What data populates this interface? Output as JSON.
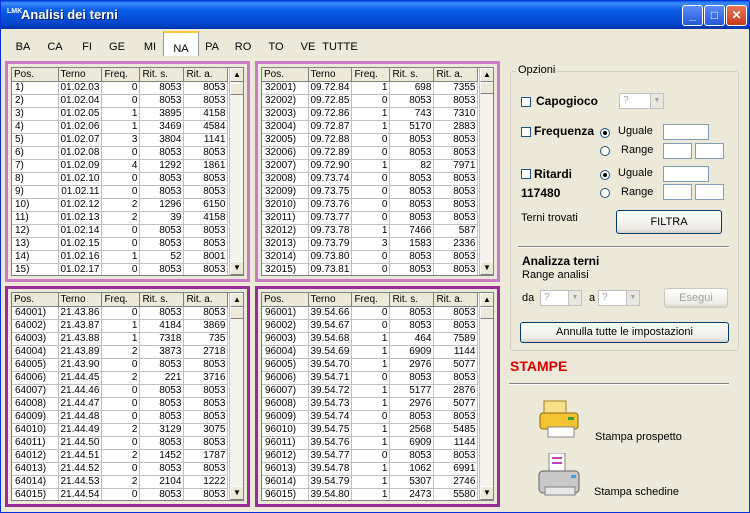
{
  "window": {
    "title": "Analisi dei terni",
    "icon_text": "LMK"
  },
  "title_buttons": {
    "minimize": "_",
    "maximize": "□",
    "close": "✕"
  },
  "tabs": [
    "BA",
    "CA",
    "FI",
    "GE",
    "MI",
    "NA",
    "PA",
    "RO",
    "TO",
    "VE",
    "TUTTE"
  ],
  "active_tab": "NA",
  "columns": [
    "Pos.",
    "Terno",
    "Freq.",
    "Rit. s.",
    "Rit. a."
  ],
  "grids": [
    {
      "rows": [
        [
          "1)",
          "01.02.03",
          "0",
          "8053",
          "8053"
        ],
        [
          "2)",
          "01.02.04",
          "0",
          "8053",
          "8053"
        ],
        [
          "3)",
          "01.02.05",
          "1",
          "3895",
          "4158"
        ],
        [
          "4)",
          "01.02.06",
          "1",
          "3469",
          "4584"
        ],
        [
          "5)",
          "01.02.07",
          "3",
          "3804",
          "1141"
        ],
        [
          "6)",
          "01.02.08",
          "0",
          "8053",
          "8053"
        ],
        [
          "7)",
          "01.02.09",
          "4",
          "1292",
          "1861"
        ],
        [
          "8)",
          "01.02.10",
          "0",
          "8053",
          "8053"
        ],
        [
          "9)",
          "01.02.11",
          "0",
          "8053",
          "8053"
        ],
        [
          "10)",
          "01.02.12",
          "2",
          "1296",
          "6150"
        ],
        [
          "11)",
          "01.02.13",
          "2",
          "39",
          "4158"
        ],
        [
          "12)",
          "01.02.14",
          "0",
          "8053",
          "8053"
        ],
        [
          "13)",
          "01.02.15",
          "0",
          "8053",
          "8053"
        ],
        [
          "14)",
          "01.02.16",
          "1",
          "52",
          "8001"
        ],
        [
          "15)",
          "01.02.17",
          "0",
          "8053",
          "8053"
        ]
      ]
    },
    {
      "rows": [
        [
          "32001)",
          "09.72.84",
          "1",
          "698",
          "7355"
        ],
        [
          "32002)",
          "09.72.85",
          "0",
          "8053",
          "8053"
        ],
        [
          "32003)",
          "09.72.86",
          "1",
          "743",
          "7310"
        ],
        [
          "32004)",
          "09.72.87",
          "1",
          "5170",
          "2883"
        ],
        [
          "32005)",
          "09.72.88",
          "0",
          "8053",
          "8053"
        ],
        [
          "32006)",
          "09.72.89",
          "0",
          "8053",
          "8053"
        ],
        [
          "32007)",
          "09.72.90",
          "1",
          "82",
          "7971"
        ],
        [
          "32008)",
          "09.73.74",
          "0",
          "8053",
          "8053"
        ],
        [
          "32009)",
          "09.73.75",
          "0",
          "8053",
          "8053"
        ],
        [
          "32010)",
          "09.73.76",
          "0",
          "8053",
          "8053"
        ],
        [
          "32011)",
          "09.73.77",
          "0",
          "8053",
          "8053"
        ],
        [
          "32012)",
          "09.73.78",
          "1",
          "7466",
          "587"
        ],
        [
          "32013)",
          "09.73.79",
          "3",
          "1583",
          "2336"
        ],
        [
          "32014)",
          "09.73.80",
          "0",
          "8053",
          "8053"
        ],
        [
          "32015)",
          "09.73.81",
          "0",
          "8053",
          "8053"
        ]
      ]
    },
    {
      "rows": [
        [
          "64001)",
          "21.43.86",
          "0",
          "8053",
          "8053"
        ],
        [
          "64002)",
          "21.43.87",
          "1",
          "4184",
          "3869"
        ],
        [
          "64003)",
          "21.43.88",
          "1",
          "7318",
          "735"
        ],
        [
          "64004)",
          "21.43.89",
          "2",
          "3873",
          "2718"
        ],
        [
          "64005)",
          "21.43.90",
          "0",
          "8053",
          "8053"
        ],
        [
          "64006)",
          "21.44.45",
          "2",
          "221",
          "3716"
        ],
        [
          "64007)",
          "21.44.46",
          "0",
          "8053",
          "8053"
        ],
        [
          "64008)",
          "21.44.47",
          "0",
          "8053",
          "8053"
        ],
        [
          "64009)",
          "21.44.48",
          "0",
          "8053",
          "8053"
        ],
        [
          "64010)",
          "21.44.49",
          "2",
          "3129",
          "3075"
        ],
        [
          "64011)",
          "21.44.50",
          "0",
          "8053",
          "8053"
        ],
        [
          "64012)",
          "21.44.51",
          "2",
          "1452",
          "1787"
        ],
        [
          "64013)",
          "21.44.52",
          "0",
          "8053",
          "8053"
        ],
        [
          "64014)",
          "21.44.53",
          "2",
          "2104",
          "1222"
        ],
        [
          "64015)",
          "21.44.54",
          "0",
          "8053",
          "8053"
        ]
      ]
    },
    {
      "rows": [
        [
          "96001)",
          "39.54.66",
          "0",
          "8053",
          "8053"
        ],
        [
          "96002)",
          "39.54.67",
          "0",
          "8053",
          "8053"
        ],
        [
          "96003)",
          "39.54.68",
          "1",
          "464",
          "7589"
        ],
        [
          "96004)",
          "39.54.69",
          "1",
          "6909",
          "1144"
        ],
        [
          "96005)",
          "39.54.70",
          "1",
          "2976",
          "5077"
        ],
        [
          "96006)",
          "39.54.71",
          "0",
          "8053",
          "8053"
        ],
        [
          "96007)",
          "39.54.72",
          "1",
          "5177",
          "2876"
        ],
        [
          "96008)",
          "39.54.73",
          "1",
          "2976",
          "5077"
        ],
        [
          "96009)",
          "39.54.74",
          "0",
          "8053",
          "8053"
        ],
        [
          "96010)",
          "39.54.75",
          "1",
          "2568",
          "5485"
        ],
        [
          "96011)",
          "39.54.76",
          "1",
          "6909",
          "1144"
        ],
        [
          "96012)",
          "39.54.77",
          "0",
          "8053",
          "8053"
        ],
        [
          "96013)",
          "39.54.78",
          "1",
          "1062",
          "6991"
        ],
        [
          "96014)",
          "39.54.79",
          "1",
          "5307",
          "2746"
        ],
        [
          "96015)",
          "39.54.80",
          "1",
          "2473",
          "5580"
        ]
      ]
    }
  ],
  "options": {
    "legend": "Opzioni",
    "capogioco_label": "Capogioco",
    "capogioco_value": "?",
    "frequenza_label": "Frequenza",
    "ritardi_label": "Ritardi",
    "count": "117480",
    "uguale_label": "Uguale",
    "range_label": "Range",
    "terni_trovati_label": "Terni trovati",
    "filtra_button": "FILTRA"
  },
  "analizza": {
    "title": "Analizza terni",
    "range_label": "Range analisi",
    "da_label": "da",
    "a_label": "a",
    "da_value": "?",
    "a_value": "?",
    "esegui_button": "Esegui"
  },
  "annulla_button": "Annulla tutte le impostazioni",
  "stampe": {
    "title": "STAMPE",
    "prospetto_label": "Stampa prospetto",
    "schedine_label": "Stampa schedine"
  },
  "colors": {
    "frame_light": "#C87CC8",
    "frame_dark": "#9A2C9A",
    "stampe_red": "#E00000",
    "titlebar_blue": "#0A5FE8"
  }
}
